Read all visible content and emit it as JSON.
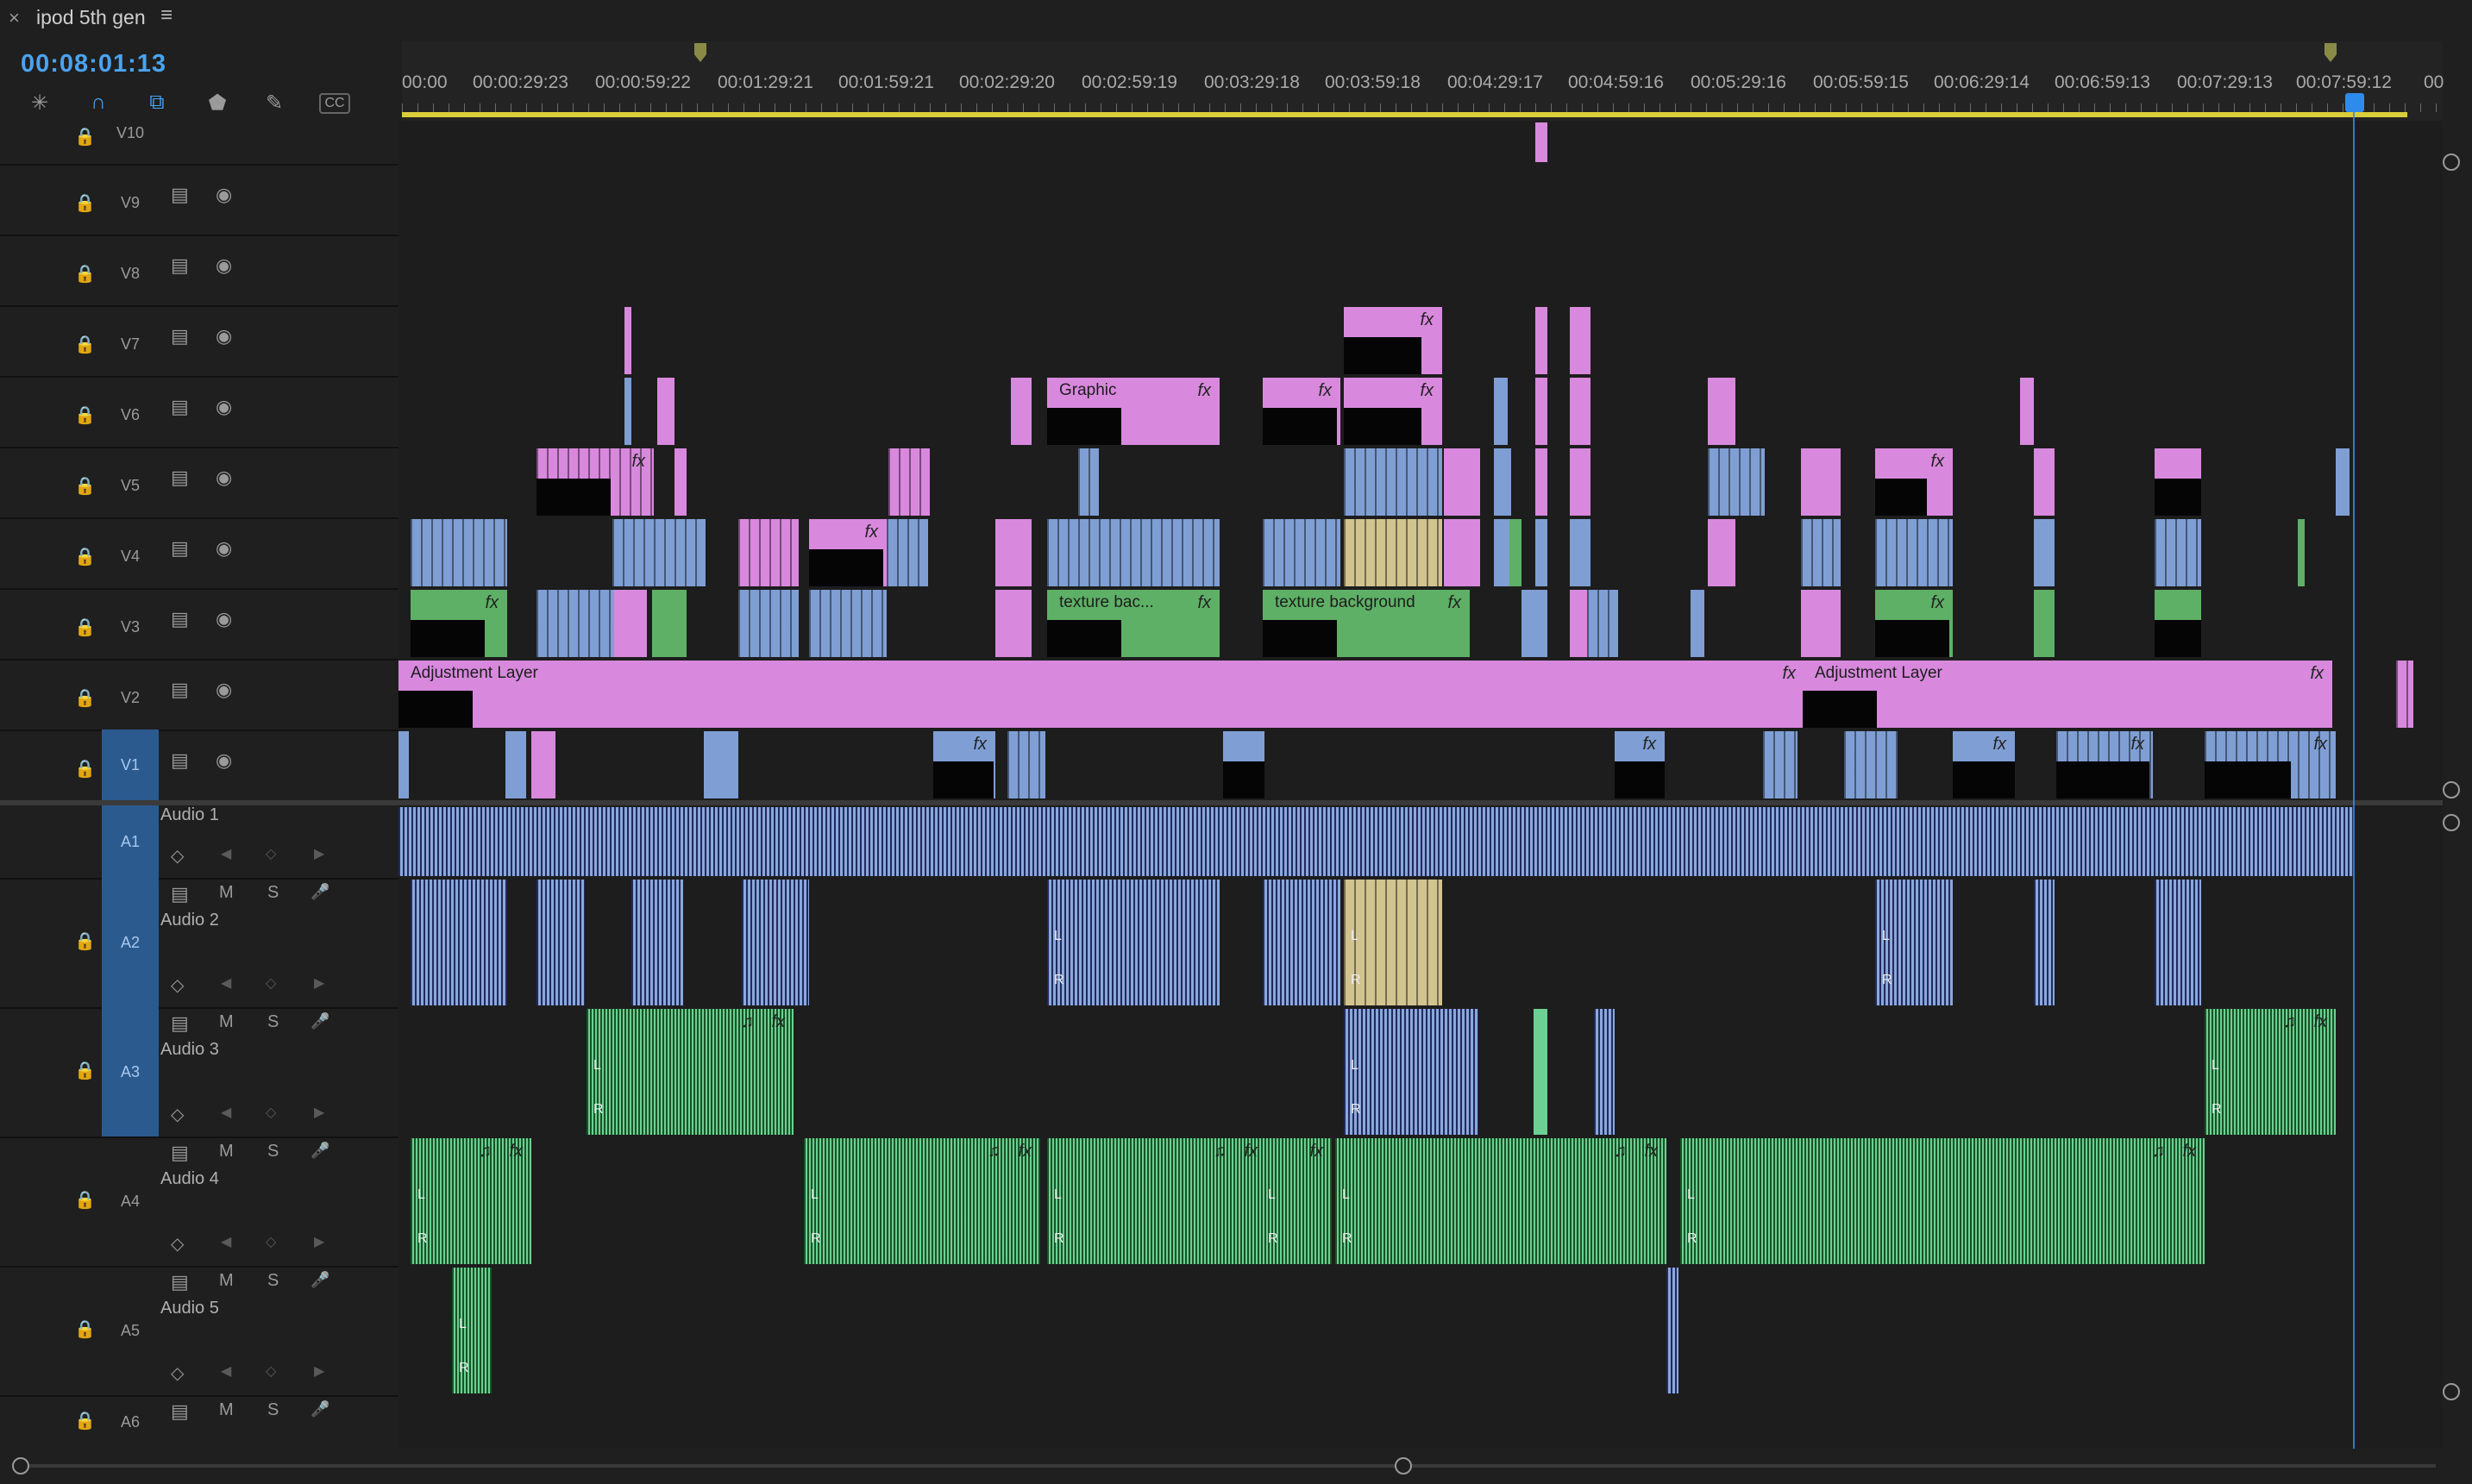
{
  "window": {
    "close_symbol": "×",
    "sequence_title": "ipod 5th gen",
    "menu_symbol": "≡"
  },
  "header": {
    "timecode": "00:08:01:13",
    "tools": [
      {
        "name": "snap-icon",
        "glyph": "⌁"
      },
      {
        "name": "magnet-icon",
        "glyph": "∩"
      },
      {
        "name": "linked-selection-icon",
        "glyph": "⧉"
      },
      {
        "name": "add-marker-icon",
        "glyph": "⬟"
      },
      {
        "name": "wrench-icon",
        "glyph": "🔧"
      },
      {
        "name": "captions-icon",
        "glyph": "CC"
      }
    ]
  },
  "ruler": {
    "labels": [
      "00:00",
      "00:00:29:23",
      "00:00:59:22",
      "00:01:29:21",
      "00:01:59:21",
      "00:02:29:20",
      "00:02:59:19",
      "00:03:29:18",
      "00:03:59:18",
      "00:04:29:17",
      "00:04:59:16",
      "00:05:29:16",
      "00:05:59:15",
      "00:06:29:14",
      "00:06:59:13",
      "00:07:29:13",
      "00:07:59:12",
      "00"
    ]
  },
  "video_tracks": [
    {
      "name": "V10"
    },
    {
      "name": "V9"
    },
    {
      "name": "V8"
    },
    {
      "name": "V7"
    },
    {
      "name": "V6"
    },
    {
      "name": "V5"
    },
    {
      "name": "V4"
    },
    {
      "name": "V3"
    },
    {
      "name": "V2"
    },
    {
      "name": "V1"
    }
  ],
  "audio_tracks": [
    {
      "name": "A1",
      "label": "Audio 1"
    },
    {
      "name": "A2",
      "label": "Audio 2"
    },
    {
      "name": "A3",
      "label": "Audio 3"
    },
    {
      "name": "A4",
      "label": "Audio 4"
    },
    {
      "name": "A5",
      "label": "Audio 5"
    },
    {
      "name": "A6",
      "label": ""
    }
  ],
  "track_buttons": {
    "mute": "M",
    "solo": "S",
    "toggle_output": "◉",
    "lock": "🔒",
    "keyframe": "◇",
    "left": "◀",
    "right": "▶",
    "mic": "🎤",
    "sync": "▤"
  },
  "clip_labels": {
    "graphic": "Graphic",
    "texture_short": "texture bac...",
    "texture": "texture background",
    "adjustment": "Adjustment Layer",
    "fx": "fx",
    "L": "L",
    "R": "R",
    "note": "♫"
  },
  "colors": {
    "accent": "#2d8ceb",
    "work_area": "#d9cd3a",
    "video_pink": "#d889dd",
    "video_blue": "#7f9fd4",
    "video_green": "#5eb066",
    "video_tan": "#d2c48f",
    "audio_blue": "#8aa8db",
    "audio_green": "#6cd092"
  }
}
